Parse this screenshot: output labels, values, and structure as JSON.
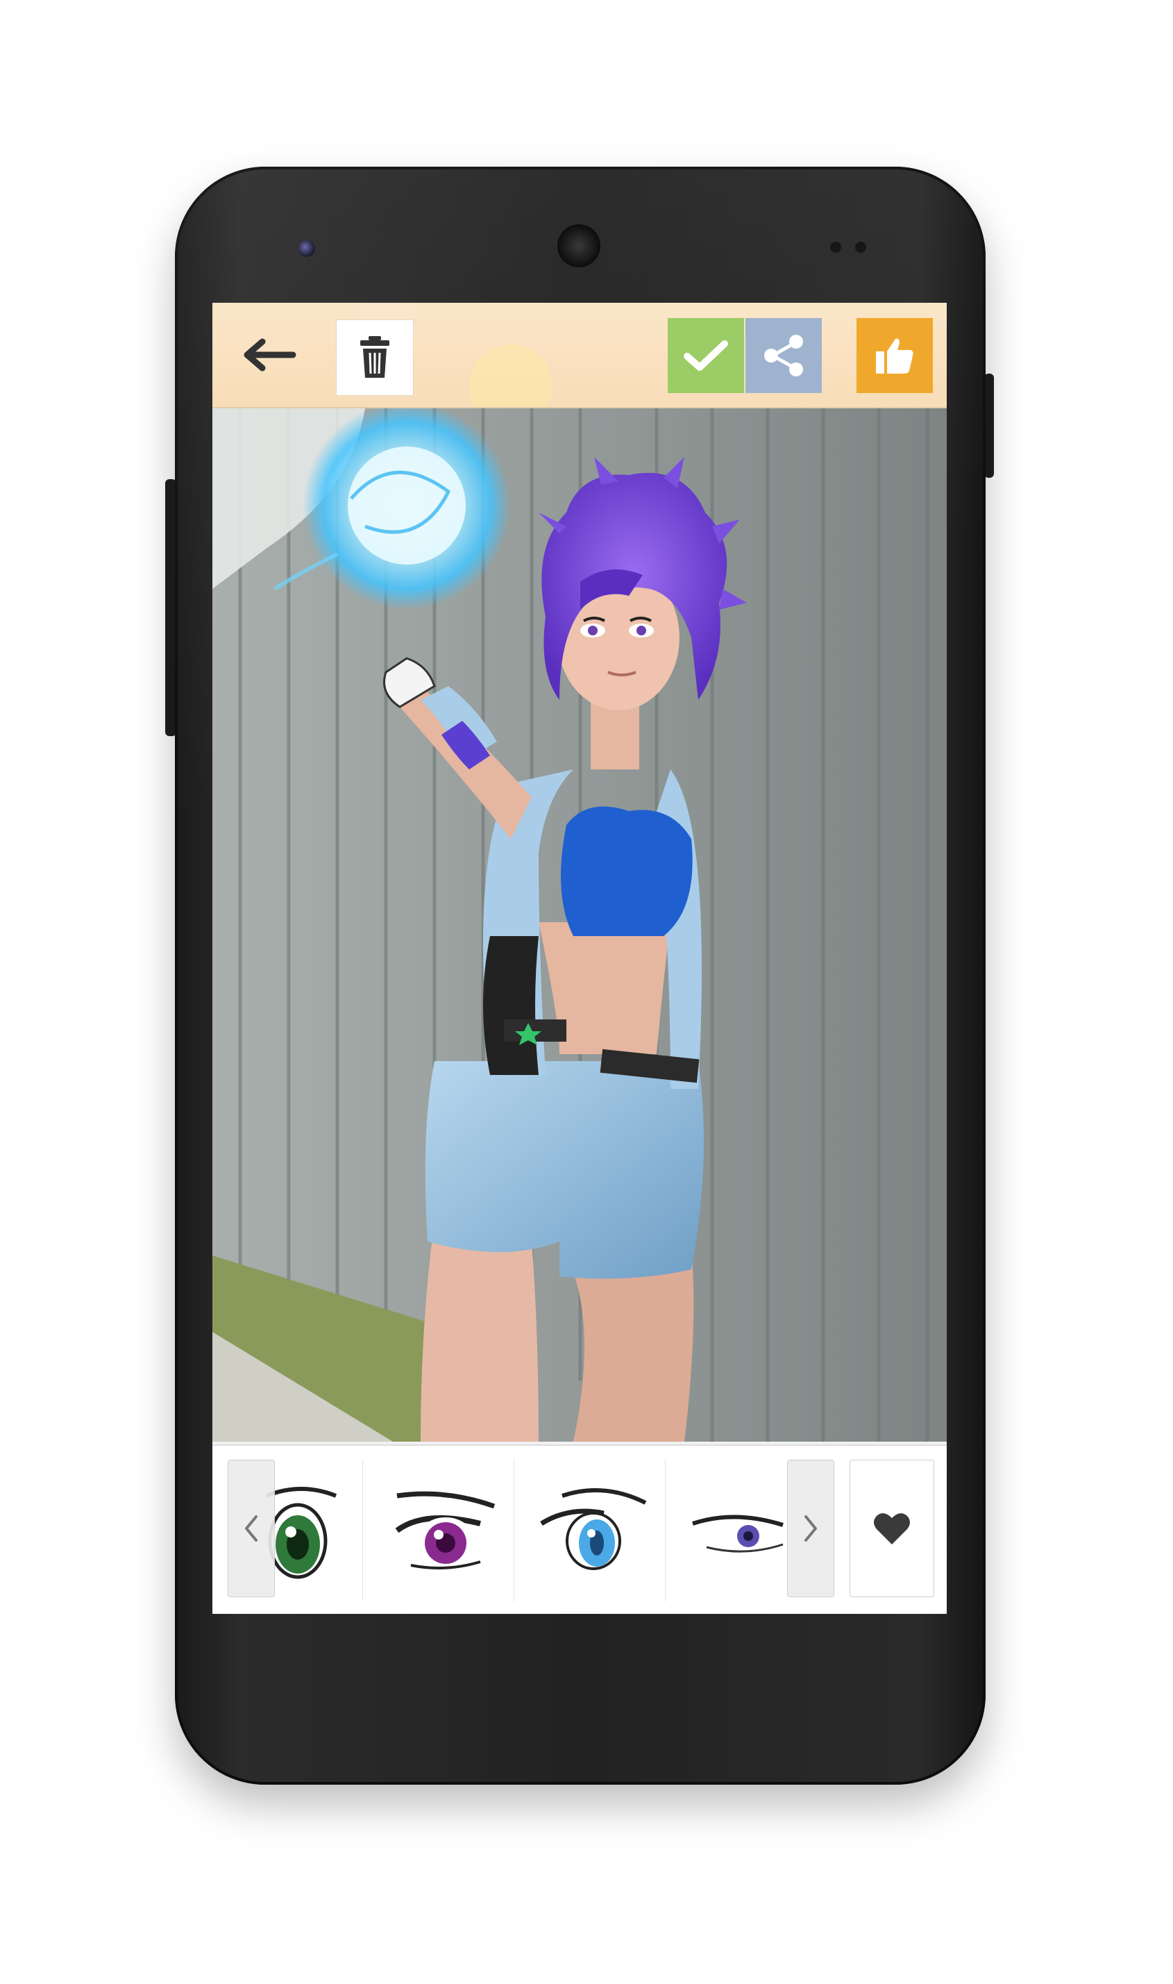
{
  "colors": {
    "toolbar_bg": "#f8ddb8",
    "check_bg": "#9ccc65",
    "share_bg": "#9fb3cf",
    "like_bg": "#f0a82c",
    "icon_dark": "#333333",
    "hair": "#6a3fd0",
    "energy_ball": "#5fd0ff",
    "top": "#1f5fd0"
  },
  "toolbar": {
    "back_icon": "arrow-left-icon",
    "trash_icon": "trash-icon",
    "actions": [
      {
        "name": "check",
        "icon": "checkmark-icon",
        "color": "#9ccc65"
      },
      {
        "name": "share",
        "icon": "share-icon",
        "color": "#9fb3cf"
      },
      {
        "name": "like",
        "icon": "thumbs-up-icon",
        "color": "#f0a82c"
      }
    ]
  },
  "tray": {
    "prev_icon": "chevron-left-icon",
    "next_icon": "chevron-right-icon",
    "favorite_icon": "heart-icon",
    "eye_styles": [
      {
        "name": "green-anime-eye",
        "iris": "#2f7a3a"
      },
      {
        "name": "purple-anime-eye",
        "iris": "#8a2a8e"
      },
      {
        "name": "blue-anime-eye",
        "iris": "#4aa9e6"
      },
      {
        "name": "violet-anime-eye",
        "iris": "#5a4fb0"
      }
    ]
  }
}
